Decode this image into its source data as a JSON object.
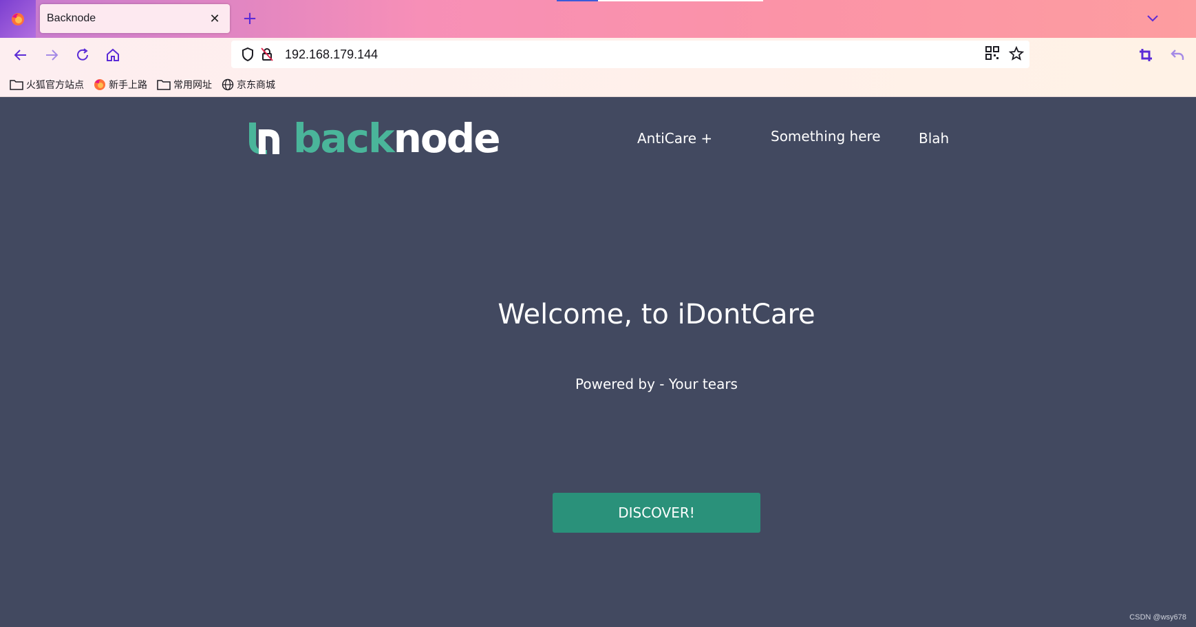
{
  "browser": {
    "tab_title": "Backnode",
    "tab_close": "✕",
    "new_tab": "+",
    "url": "192.168.179.144",
    "bookmarks": [
      {
        "label": "火狐官方站点",
        "icon": "folder-icon"
      },
      {
        "label": "新手上路",
        "icon": "firefox-icon"
      },
      {
        "label": "常用网址",
        "icon": "folder-icon"
      },
      {
        "label": "京东商城",
        "icon": "globe-icon"
      }
    ],
    "accent_color": "#5b2bd6"
  },
  "site": {
    "logo": {
      "part1": "back",
      "part2": "node"
    },
    "nav": [
      "AntiCare +",
      "Something here",
      "Blah"
    ],
    "hero_title": "Welcome, to iDontCare",
    "hero_subtitle": "Powered by - Your tears",
    "cta_label": "DISCOVER!",
    "colors": {
      "background": "#424960",
      "brand_green": "#4ab59a",
      "button": "#2a917a"
    }
  },
  "watermark": "CSDN @wsy678"
}
